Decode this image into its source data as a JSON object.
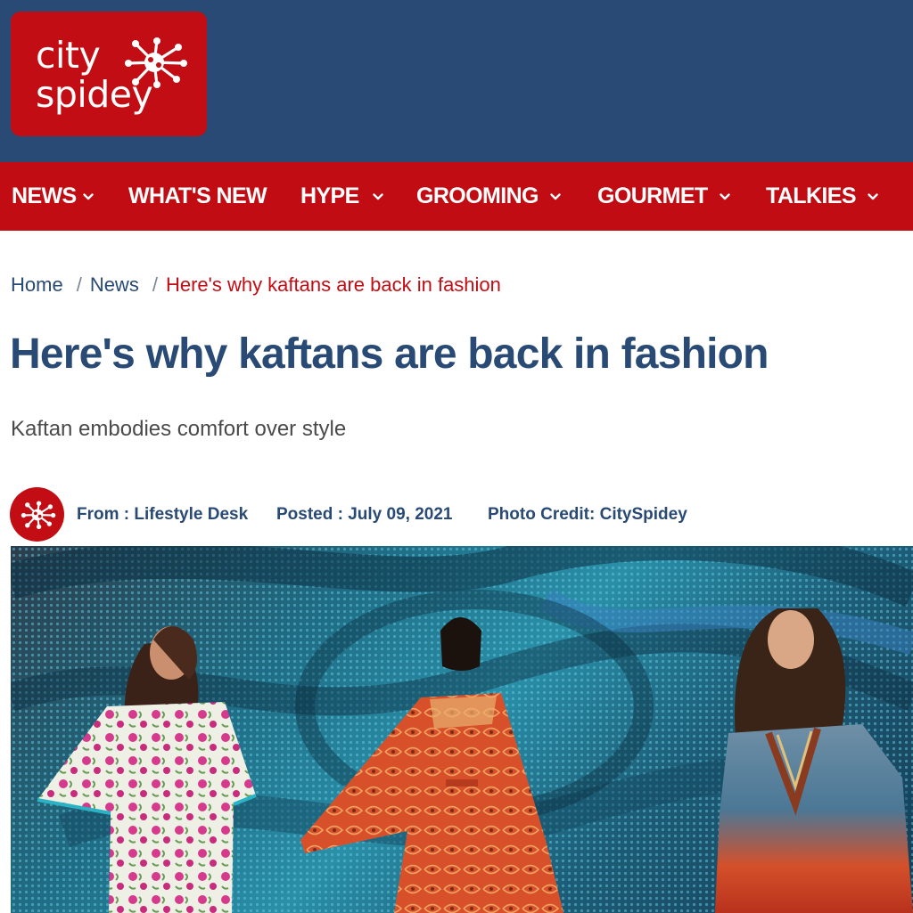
{
  "brand": {
    "line1": "city",
    "line2": "spidey",
    "colors": {
      "header_bg": "#284a74",
      "brand_red": "#c10d13",
      "nav_bg": "#c20c13"
    }
  },
  "nav": {
    "items": [
      {
        "label": "NEWS",
        "has_dropdown": true
      },
      {
        "label": "WHAT'S NEW",
        "has_dropdown": false
      },
      {
        "label": "HYPE",
        "has_dropdown": true
      },
      {
        "label": "GROOMING",
        "has_dropdown": true
      },
      {
        "label": "GOURMET",
        "has_dropdown": true
      },
      {
        "label": "TALKIES",
        "has_dropdown": true
      }
    ]
  },
  "breadcrumb": {
    "home": "Home",
    "section": "News",
    "current": "Here's why kaftans are back in fashion",
    "separator": "/"
  },
  "article": {
    "title": "Here's why kaftans are back in fashion",
    "subtitle": "Kaftan embodies comfort over style",
    "from": "From : Lifestyle Desk",
    "posted": "Posted : July 09, 2021",
    "photo_credit": "Photo Credit: CitySpidey"
  },
  "icons": {
    "logo": "spider-icon",
    "avatar": "spider-icon",
    "dropdown": "chevron-down-icon"
  }
}
